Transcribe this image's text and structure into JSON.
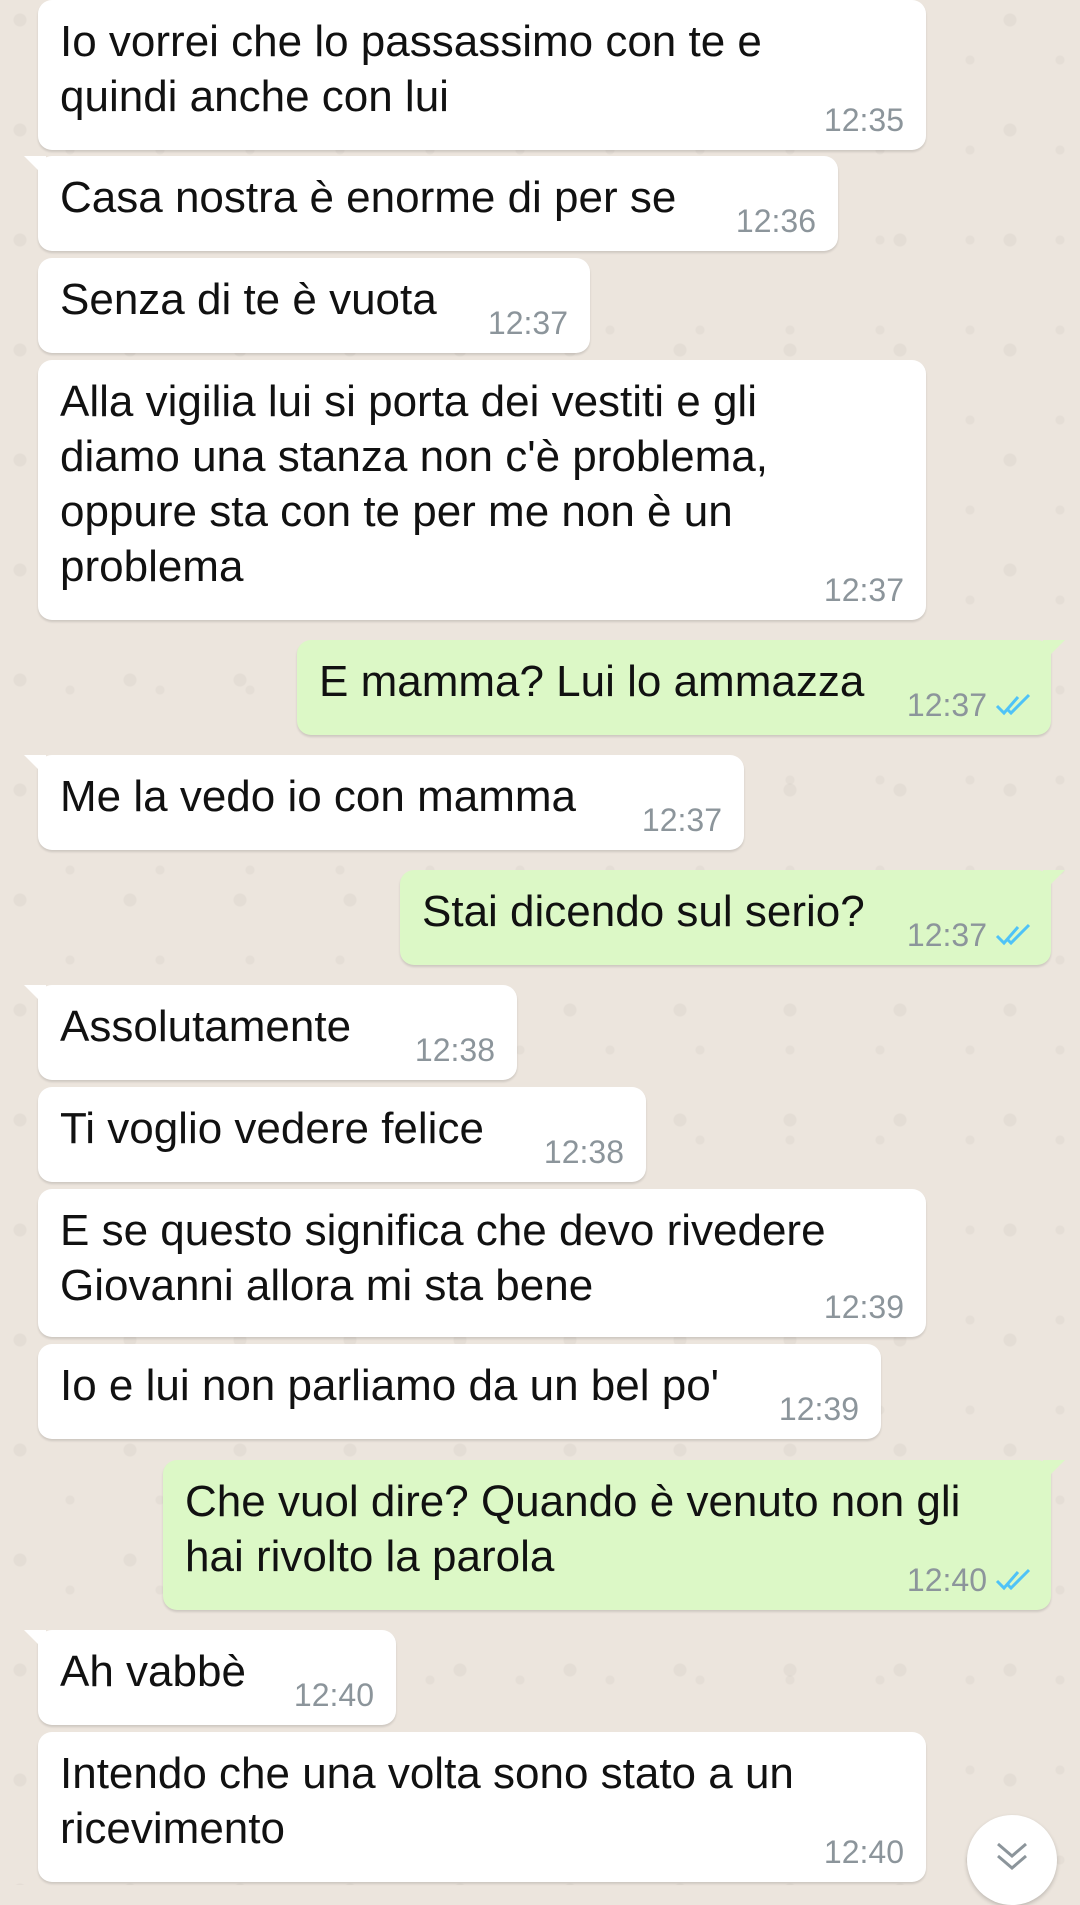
{
  "messages": [
    {
      "dir": "in",
      "text": "Io vorrei che lo passassimo con te e\nquindi anche con lui",
      "time": "12:35"
    },
    {
      "dir": "in",
      "text": "Casa nostra è enorme di per se",
      "time": "12:36"
    },
    {
      "dir": "in",
      "text": "Senza di te è vuota",
      "time": "12:37"
    },
    {
      "dir": "in",
      "text": "Alla vigilia lui si porta dei vestiti e gli\ndiamo una stanza non c'è problema,\noppure sta con te per me non è un\nproblema",
      "time": "12:37"
    },
    {
      "dir": "out",
      "text": "E mamma? Lui lo ammazza",
      "time": "12:37",
      "status": "read"
    },
    {
      "dir": "in",
      "text": "Me la vedo io con mamma",
      "time": "12:37"
    },
    {
      "dir": "out",
      "text": "Stai dicendo sul serio?",
      "time": "12:37",
      "status": "read"
    },
    {
      "dir": "in",
      "text": "Assolutamente",
      "time": "12:38"
    },
    {
      "dir": "in",
      "text": "Ti voglio vedere felice",
      "time": "12:38"
    },
    {
      "dir": "in",
      "text": "E se questo significa che devo rivedere\nGiovanni allora mi sta bene",
      "time": "12:39"
    },
    {
      "dir": "in",
      "text": "Io e lui non parliamo da un bel po'",
      "time": "12:39"
    },
    {
      "dir": "out",
      "text": "Che vuol dire? Quando è venuto non gli\nhai rivolto la parola",
      "time": "12:40",
      "status": "read"
    },
    {
      "dir": "in",
      "text": "Ah vabbè",
      "time": "12:40"
    },
    {
      "dir": "in",
      "text": "Intendo che una volta sono stato a un\nricevimento",
      "time": "12:40"
    }
  ],
  "colors": {
    "incoming_bubble": "#ffffff",
    "outgoing_bubble": "#dcf8c6",
    "read_ticks": "#4fc3f7",
    "timestamp": "#8c959b",
    "background": "#ece5dd"
  },
  "icons": {
    "read_status": "double-check-icon",
    "scroll_down": "double-chevron-down-icon"
  }
}
